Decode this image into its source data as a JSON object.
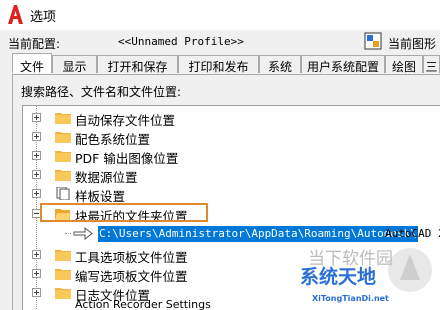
{
  "window": {
    "title": "选项",
    "app_icon": "autocad-logo-icon"
  },
  "profile": {
    "current_profile_label": "当前配置:",
    "current_profile_value": "<<Unnamed Profile>>",
    "current_drawing_label": "当前图形"
  },
  "tabs": [
    {
      "label": "文件"
    },
    {
      "label": "显示"
    },
    {
      "label": "打开和保存"
    },
    {
      "label": "打印和发布"
    },
    {
      "label": "系统"
    },
    {
      "label": "用户系统配置"
    },
    {
      "label": "绘图"
    },
    {
      "label": "三"
    }
  ],
  "tree": {
    "heading": "搜索路径、文件名和文件位置:",
    "items": [
      {
        "label": "自动保存文件位置"
      },
      {
        "label": "配色系统位置"
      },
      {
        "label": "PDF 输出图像位置"
      },
      {
        "label": "数据源位置"
      },
      {
        "label": "样板设置"
      },
      {
        "label": "块最近的文件夹位置"
      },
      {
        "label": "工具选项板文件位置"
      },
      {
        "label": "编写选项板文件位置"
      },
      {
        "label": "日志文件位置"
      },
      {
        "label": "Action Recorder Settings"
      }
    ],
    "expanded_path": {
      "selected": "C:\\Users\\Administrator\\AppData\\Roaming\\Autodesk\\",
      "rest": "AutoCAD 2"
    }
  },
  "watermark": {
    "title": "当下软件园",
    "brand": "系统天地",
    "url": "XiTongTianDi.net"
  },
  "colors": {
    "accent": "#e08a2c",
    "selection": "#0078d7",
    "folder": "#f2b640"
  }
}
